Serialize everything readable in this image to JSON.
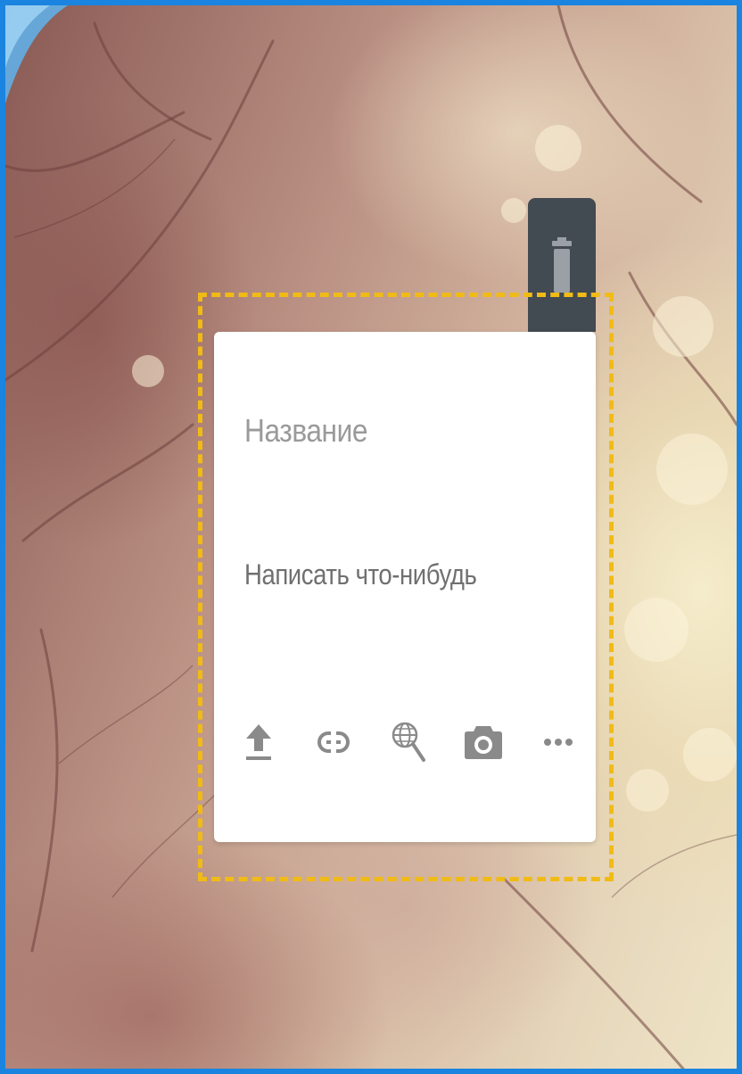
{
  "editor": {
    "title_placeholder": "Название",
    "text_placeholder": "Написать что-нибудь"
  },
  "actions": {
    "delete_icon": "trash-icon"
  },
  "toolbar": {
    "items": [
      {
        "icon": "upload-icon"
      },
      {
        "icon": "link-icon"
      },
      {
        "icon": "web-search-icon"
      },
      {
        "icon": "camera-icon"
      },
      {
        "icon": "more-icon"
      }
    ]
  },
  "colors": {
    "frame_border": "#1a84e0",
    "selection_dash": "#f1bb16",
    "delete_bg": "#424a52",
    "icon_gray": "#8a8a8a"
  }
}
